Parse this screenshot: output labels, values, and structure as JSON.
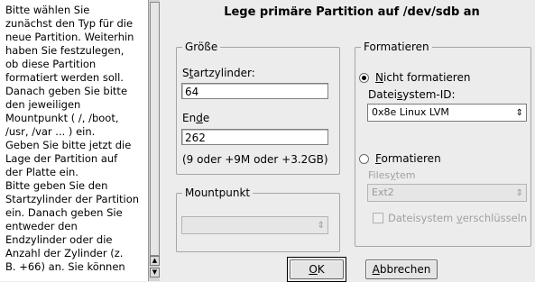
{
  "help": {
    "text": "Bitte wählen Sie\nzunächst den Typ für die\nneue Partition. Weiterhin\nhaben Sie festzulegen,\nob diese Partition\nformatiert werden soll.\nDanach geben Sie bitte\nden jeweiligen\nMountpunkt ( /, /boot,\n/usr, /var ... ) ein.\nGeben Sie bitte jetzt die\nLage der Partition auf\nder Platte ein.\nBitte geben Sie den\nStartzylinder der Partition\nein. Danach geben Sie\nentweder den\nEndzylinder oder die\nAnzahl der Zylinder (z.\nB. +66) an. Sie können"
  },
  "dialog": {
    "title": "Lege primäre Partition auf /dev/sdb an"
  },
  "size": {
    "legend": "Größe",
    "start_label_pre": "S",
    "start_label_acc": "t",
    "start_label_post": "artzylinder:",
    "start_value": "64",
    "end_label_pre": "En",
    "end_label_acc": "d",
    "end_label_post": "e",
    "end_value": "262",
    "hint": "(9 oder +9M oder +3.2GB)"
  },
  "mount": {
    "legend": "Mountpunkt",
    "value": ""
  },
  "format": {
    "legend": "Formatieren",
    "no_format_acc": "N",
    "no_format_post": "icht formatieren",
    "fsid_pre": "Datei",
    "fsid_acc": "s",
    "fsid_post": "ystem-ID:",
    "fsid_value": "0x8e Linux LVM",
    "do_format_acc": "F",
    "do_format_post": "ormatieren",
    "fs_label_pre": "Files",
    "fs_label_acc": "y",
    "fs_label_post": "tem",
    "fs_value": "Ext2",
    "encrypt_pre": "Dateisystem ",
    "encrypt_acc": "v",
    "encrypt_post": "erschlüsseln"
  },
  "buttons": {
    "ok_acc": "O",
    "ok_post": "K",
    "cancel_acc": "A",
    "cancel_post": "bbrechen"
  }
}
